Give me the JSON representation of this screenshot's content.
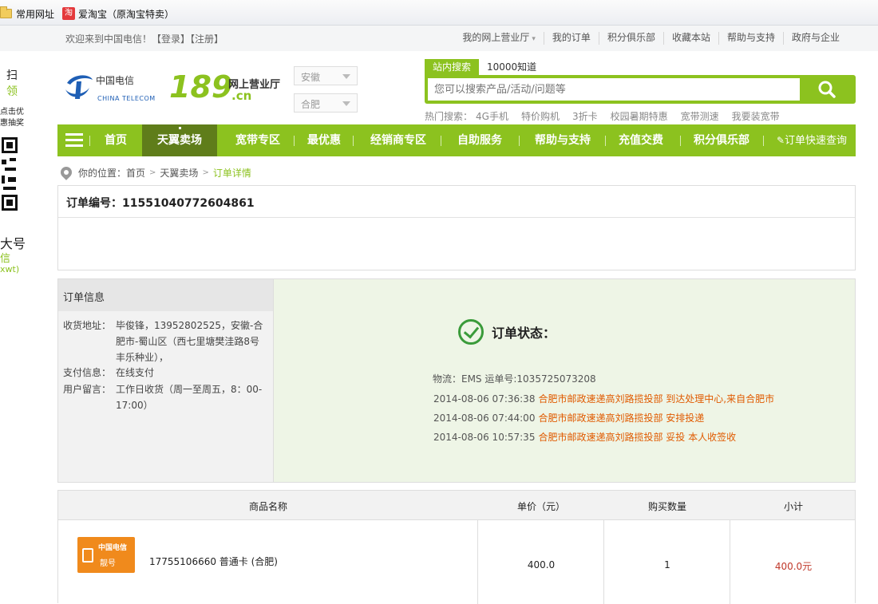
{
  "bookmarks": {
    "common": "常用网址",
    "taobao_icon": "淘",
    "taobao": "爱淘宝（原淘宝特卖）"
  },
  "topbar": {
    "welcome": "欢迎来到中国电信！【登录】【注册】",
    "links": [
      "我的网上营业厅",
      "我的订单",
      "积分俱乐部",
      "收藏本站",
      "帮助与支持",
      "政府与企业"
    ]
  },
  "side": {
    "scan": "扫",
    "get": "领",
    "click": "点击优",
    "lottery": "惠抽奖",
    "hao": "大号",
    "xin": "信",
    "wt": "xwt)"
  },
  "logo": {
    "cn": "中国电信",
    "en": "CHINA TELECOM",
    "num": "189",
    "dotcn": ".cn",
    "hall": "网上营业厅"
  },
  "region": {
    "province": "安徽",
    "city": "合肥"
  },
  "search": {
    "tab_active": "站内搜索",
    "tab_other": "10000知道",
    "placeholder": "您可以搜索产品/活动/问题等",
    "hot_label": "热门搜索：",
    "hot": [
      "4G手机",
      "特价购机",
      "3折卡",
      "校园暑期特惠",
      "宽带测速",
      "我要装宽带"
    ]
  },
  "nav": {
    "items": [
      "首页",
      "天翼卖场",
      "宽带专区",
      "最优惠",
      "经销商专区",
      "自助服务",
      "帮助与支持",
      "充值交费",
      "积分俱乐部"
    ],
    "quick": "订单快速查询"
  },
  "breadcrumb": {
    "label": "你的位置：",
    "home": "首页",
    "mall": "天翼卖场",
    "current": "订单详情"
  },
  "order": {
    "number_label": "订单编号：",
    "number": "11551040772604861"
  },
  "info": {
    "title": "订单信息",
    "address_label": "收货地址：",
    "address": "毕俊锋，13952802525，安徽-合肥市-蜀山区（西七里塘樊洼路8号 丰乐种业），",
    "pay_label": "支付信息：",
    "pay": "在线支付",
    "note_label": "用户留言：",
    "note": "工作日收货（周一至周五，8：00-17:00）",
    "status_label": "订单状态：",
    "logistics": "物流：EMS 运单号:1035725073208",
    "tracks": [
      {
        "time": "2014-08-06 07:36:38",
        "desc": "合肥市邮政速递高刘路揽投部 到达处理中心,来自合肥市"
      },
      {
        "time": "2014-08-06 07:44:00",
        "desc": "合肥市邮政速递高刘路揽投部 安排投递"
      },
      {
        "time": "2014-08-06 10:57:35",
        "desc": "合肥市邮政速递高刘路揽投部 妥投 本人收签收"
      }
    ]
  },
  "products": {
    "headers": [
      "商品名称",
      "单价（元）",
      "购买数量",
      "小计"
    ],
    "rows": [
      {
        "name": "17755106660 普通卡 (合肥)",
        "price": "400.0",
        "qty": "1",
        "subtotal": "400.0元",
        "card_brand": "中国电信",
        "card_label": "靓号"
      }
    ]
  },
  "colors": {
    "accent": "#8cc21f",
    "nav_active": "#5f7d1a",
    "track": "#e05a00",
    "price": "#c0392b"
  }
}
